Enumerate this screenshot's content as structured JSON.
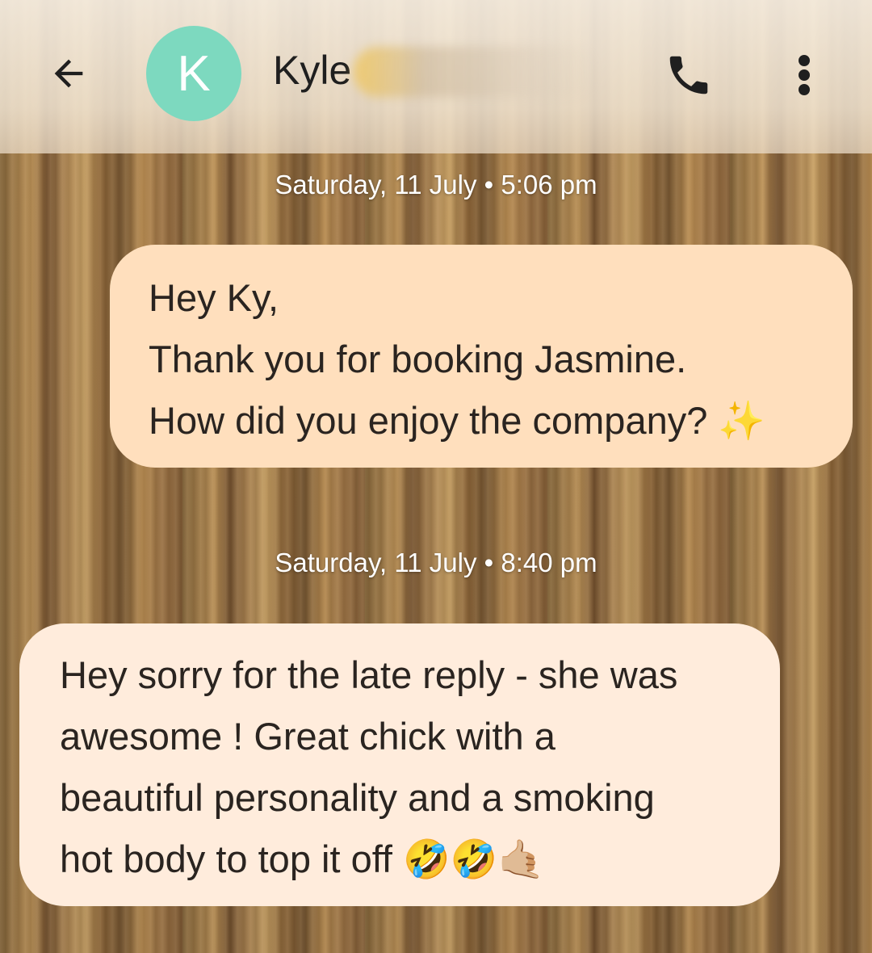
{
  "header": {
    "avatar_letter": "K",
    "contact_name": "Kyle",
    "avatar_color": "#7dd9bf"
  },
  "icons": {
    "back": "arrow-left-icon",
    "call": "phone-icon",
    "more": "more-vert-icon"
  },
  "messages": [
    {
      "timestamp": "Saturday, 11 July • 5:06 pm",
      "direction": "outgoing",
      "bubble_color": "#ffdfbd",
      "lines": [
        "Hey Ky,",
        "Thank you for booking Jasmine.",
        "How did you enjoy the company? ✨"
      ]
    },
    {
      "timestamp": "Saturday, 11 July • 8:40 pm",
      "direction": "incoming",
      "bubble_color": "#ffecdc",
      "lines": [
        "Hey sorry for the late reply - she was",
        "awesome ! Great chick with a",
        "beautiful personality and a smoking",
        "hot body to top it off 🤣🤣🤙🏼"
      ]
    }
  ]
}
